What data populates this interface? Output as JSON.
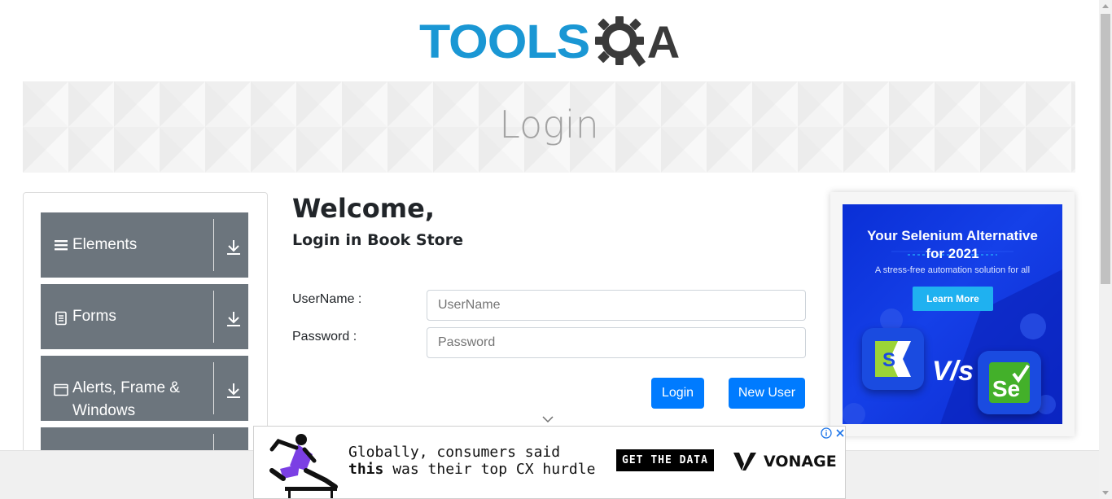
{
  "header": {
    "logo_text_primary": "TOOLS",
    "logo_text_secondary": "A",
    "colors": {
      "primary": "#1a97d4",
      "secondary": "#3a3a3a"
    }
  },
  "banner": {
    "title": "Login"
  },
  "sidebar": {
    "groups": [
      {
        "label": "Elements",
        "icon": "hamburger-icon"
      },
      {
        "label": "Forms",
        "icon": "document-icon"
      },
      {
        "label": "Alerts, Frame & Windows",
        "icon": "window-icon"
      },
      {
        "label": "",
        "icon": ""
      }
    ],
    "group_bg_color": "#6c757d"
  },
  "login": {
    "heading": "Welcome,",
    "subheading": "Login in Book Store",
    "username_label": "UserName :",
    "username_placeholder": "UserName",
    "username_value": "",
    "password_label": "Password :",
    "password_placeholder": "Password",
    "password_value": "",
    "login_button": "Login",
    "new_user_button": "New User",
    "button_color": "#007bff"
  },
  "ad_right": {
    "title_line1": "Your Selenium Alternative",
    "title_line2": "for 2021",
    "subtitle": "A stress-free automation solution for all",
    "cta": "Learn More",
    "vs_text": "V/s",
    "logo_left_letter": "S",
    "logo_right_letter": "Se"
  },
  "ad_bottom": {
    "line1": "Globally, consumers said",
    "line2_bold": "this",
    "line2_rest": " was their top CX hurdle",
    "cta": "GET THE DATA",
    "brand": "VONAGE"
  }
}
